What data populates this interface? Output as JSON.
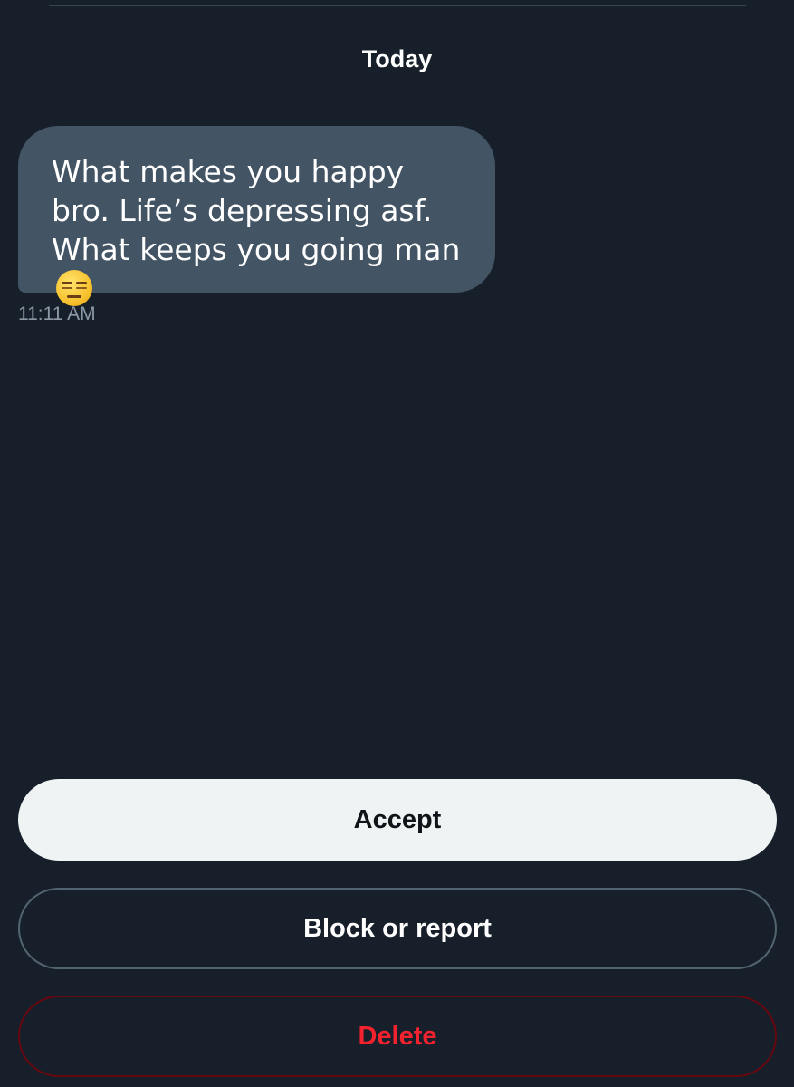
{
  "conversation": {
    "date_separator": "Today",
    "messages": [
      {
        "text": "What makes you happy bro. Life’s depressing asf. What keeps you going man",
        "emoji": "expressionless-face-emoji",
        "time": "11:11 AM"
      }
    ]
  },
  "actions": {
    "accept_label": "Accept",
    "block_label": "Block or report",
    "delete_label": "Delete"
  },
  "colors": {
    "background": "#17202a",
    "bubble": "#435464",
    "accept_bg": "#eff3f4",
    "delete_text": "#f4212e"
  }
}
